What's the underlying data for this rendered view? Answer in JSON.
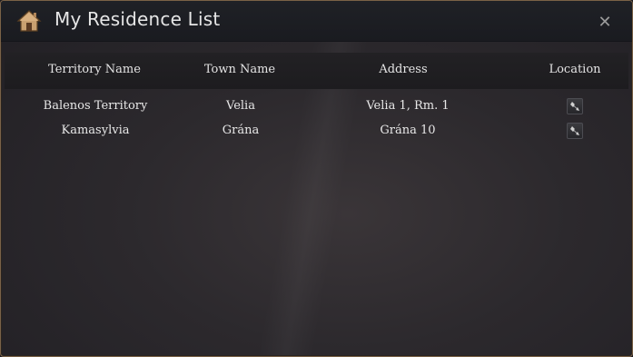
{
  "window": {
    "title": "My Residence List",
    "close_glyph": "✕",
    "title_icon": "house-icon"
  },
  "table": {
    "columns": [
      "Territory Name",
      "Town Name",
      "Address",
      "Location"
    ],
    "rows": [
      {
        "territory": "Balenos Territory",
        "town": "Velia",
        "address": "Velia 1, Rm. 1",
        "location_icon": "navigate-icon"
      },
      {
        "territory": "Kamasylvia",
        "town": "Grána",
        "address": "Grána 10",
        "location_icon": "navigate-icon"
      }
    ]
  }
}
